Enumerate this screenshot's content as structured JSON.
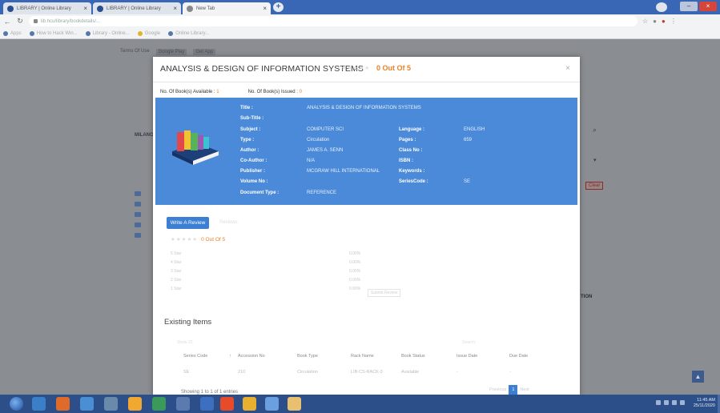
{
  "browser": {
    "tabs": [
      {
        "label": "LIBRARY | Online Library",
        "active": false
      },
      {
        "label": "LIBRARY | Online Library",
        "active": false
      },
      {
        "label": "New Tab",
        "active": true
      }
    ],
    "address": "lib.hcu/library/bookdetails/...",
    "bookmarks": [
      "Apps",
      "How to Hack Win...",
      "Library - Online...",
      "Google",
      "Online Library..."
    ],
    "colors": {
      "chrome": "#3a66b6",
      "accent": "#3d7fd3",
      "orange": "#e8832a",
      "card": "#4a8ad8"
    }
  },
  "background_page": {
    "top_links": [
      "Terms Of Use",
      "Google Play",
      "Get App"
    ],
    "sidebar_heading": "MILANO",
    "clear_label": "Clear",
    "section_fragment": "TION"
  },
  "modal": {
    "title": "ANALYSIS & DESIGN OF INFORMATION SYSTEMS",
    "rating_text": "0 Out Of 5",
    "counts": {
      "available_label": "No. Of Book(s) Available :",
      "available_value": "1",
      "issued_label": "No. Of Book(s) Issued :",
      "issued_value": "0"
    },
    "details_left": [
      {
        "label": "Title :",
        "value": "ANALYSIS & DESIGN OF INFORMATION SYSTEMS"
      },
      {
        "label": "Sub-Title :",
        "value": ""
      },
      {
        "label": "Subject :",
        "value": "COMPUTER SCI"
      },
      {
        "label": "Type :",
        "value": "Circulation"
      },
      {
        "label": "Author :",
        "value": "JAMES A. SENN"
      },
      {
        "label": "Co-Author :",
        "value": "N/A"
      },
      {
        "label": "Publisher :",
        "value": "MCGRAW HILL INTERNATIONAL"
      },
      {
        "label": "Volume No :",
        "value": ""
      },
      {
        "label": "Document Type :",
        "value": "REFERENCE"
      }
    ],
    "details_right": [
      {
        "label": "Language :",
        "value": "ENGLISH"
      },
      {
        "label": "Pages :",
        "value": "659"
      },
      {
        "label": "Class No :",
        "value": ""
      },
      {
        "label": "ISBN :",
        "value": ""
      },
      {
        "label": "Keywords :",
        "value": ""
      },
      {
        "label": "SeriesCode :",
        "value": "SE"
      }
    ],
    "review": {
      "button_label": "Write A Review",
      "ghost_button_label": "Reviews",
      "rating_text": "0 Out Of 5",
      "star_rows": [
        {
          "label": "5 Star",
          "pct": "0.00%"
        },
        {
          "label": "4 Star",
          "pct": "0.00%"
        },
        {
          "label": "3 Star",
          "pct": "0.00%"
        },
        {
          "label": "2 Star",
          "pct": "0.00%"
        },
        {
          "label": "1 Star",
          "pct": "0.00%"
        }
      ],
      "submit_label": "Submit Review"
    },
    "existing": {
      "heading": "Existing Items",
      "show_label": "Show 10",
      "search_label": "Search:",
      "columns": [
        "Series Code",
        "Accession No",
        "Book Type",
        "Rack Name",
        "Book Status",
        "Issue Date",
        "Due Date"
      ],
      "rows": [
        [
          "SE",
          "210",
          "Circulation",
          "LIB-CS-RACK-3",
          "Available",
          "-",
          "-"
        ]
      ],
      "showing": "Showing 1 to 1 of 1 entries",
      "pager": {
        "prev": "Previous",
        "current": "1",
        "next": "Next"
      }
    }
  },
  "taskbar": {
    "time": "11:45 AM",
    "date": "25/11/2020"
  }
}
